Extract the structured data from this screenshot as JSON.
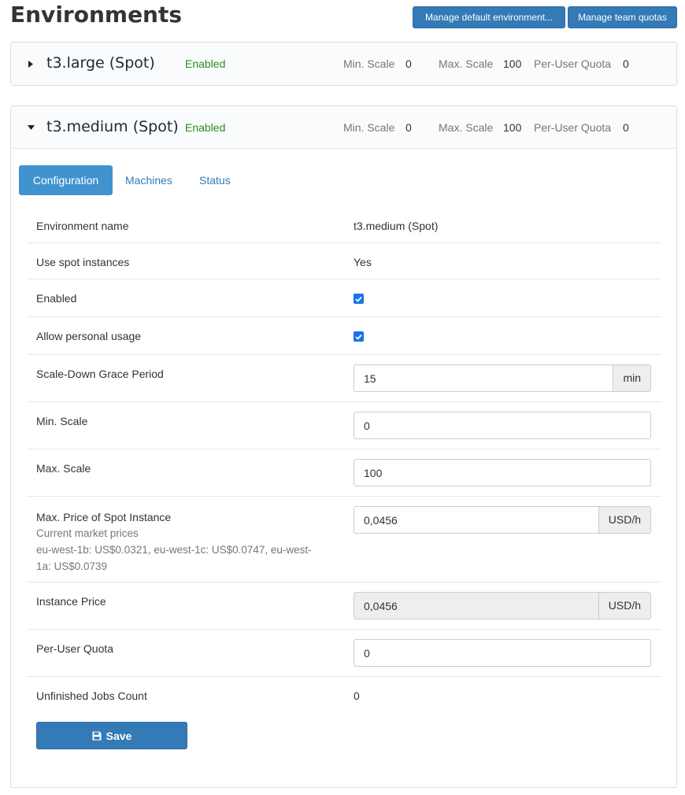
{
  "page": {
    "title": "Environments",
    "manage_default_label": "Manage default environment...",
    "manage_quotas_label": "Manage team quotas"
  },
  "environments": [
    {
      "name": "t3.large (Spot)",
      "status": "Enabled",
      "min_scale_label": "Min. Scale",
      "min_scale": "0",
      "max_scale_label": "Max. Scale",
      "max_scale": "100",
      "quota_label": "Per-User Quota",
      "quota": "0",
      "expanded": false
    },
    {
      "name": "t3.medium (Spot)",
      "status": "Enabled",
      "min_scale_label": "Min. Scale",
      "min_scale": "0",
      "max_scale_label": "Max. Scale",
      "max_scale": "100",
      "quota_label": "Per-User Quota",
      "quota": "0",
      "expanded": true
    }
  ],
  "tabs": {
    "configuration": "Configuration",
    "machines": "Machines",
    "status": "Status",
    "active": "configuration"
  },
  "config": {
    "env_name_label": "Environment name",
    "env_name_value": "t3.medium (Spot)",
    "spot_label": "Use spot instances",
    "spot_value": "Yes",
    "enabled_label": "Enabled",
    "enabled_checked": true,
    "personal_label": "Allow personal usage",
    "personal_checked": true,
    "grace_label": "Scale-Down Grace Period",
    "grace_value": "15",
    "grace_unit": "min",
    "min_scale_label": "Min. Scale",
    "min_scale_value": "0",
    "max_scale_label": "Max. Scale",
    "max_scale_value": "100",
    "max_price_label": "Max. Price of Spot Instance",
    "market_prices_label": "Current market prices",
    "market_prices_line1": "eu-west-1b: US$0.0321, eu-west-1c: US$0.0747, eu-west-",
    "market_prices_line2": "1a: US$0.0739",
    "max_price_value": "0,0456",
    "max_price_unit": "USD/h",
    "instance_price_label": "Instance Price",
    "instance_price_value": "0,0456",
    "instance_price_unit": "USD/h",
    "quota_label": "Per-User Quota",
    "quota_value": "0",
    "unfinished_label": "Unfinished Jobs Count",
    "unfinished_value": "0",
    "save_label": "Save"
  },
  "colors": {
    "primary": "#337ab7",
    "active_tab": "#4193cf",
    "enabled_text": "#2e8b1f"
  }
}
